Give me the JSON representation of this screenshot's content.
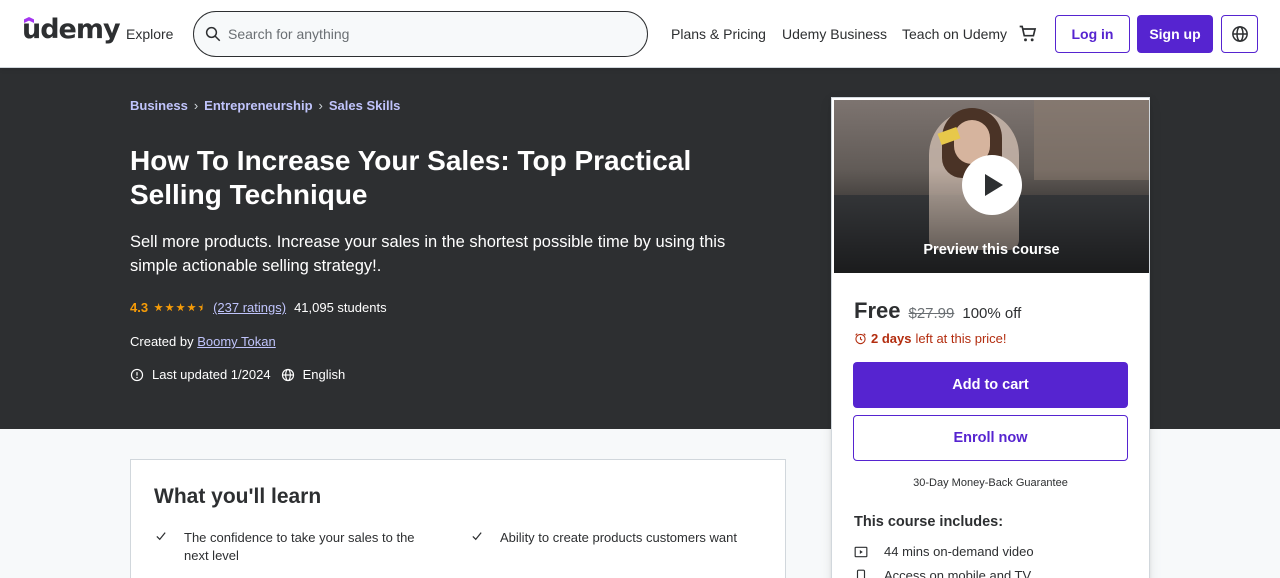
{
  "header": {
    "logo": "udemy",
    "explore": "Explore",
    "search_placeholder": "Search for anything",
    "search_value": "",
    "links": [
      "Plans & Pricing",
      "Udemy Business",
      "Teach on Udemy"
    ],
    "login": "Log in",
    "signup": "Sign up",
    "accent": "#5624d0"
  },
  "breadcrumbs": [
    "Business",
    "Entrepreneurship",
    "Sales Skills"
  ],
  "course": {
    "title": "How To Increase Your Sales: Top Practical Selling Technique",
    "subtitle": "Sell more products. Increase your sales in the shortest possible time by using this simple actionable selling strategy!.",
    "rating": "4.3",
    "rating_stars": 4.3,
    "ratings_link": "(237 ratings)",
    "students": "41,095 students",
    "created_by_label": "Created by",
    "instructor": "Boomy Tokan",
    "last_updated": "Last updated 1/2024",
    "language": "English"
  },
  "card": {
    "preview_label": "Preview this course",
    "price": "Free",
    "original_price": "$27.99",
    "discount": "100% off",
    "timer_bold": "2 days",
    "timer_text": "left at this price!",
    "add_to_cart": "Add to cart",
    "enroll": "Enroll now",
    "guarantee": "30-Day Money-Back Guarantee",
    "includes_title": "This course includes:",
    "includes": [
      "44 mins on-demand video",
      "Access on mobile and TV"
    ]
  },
  "learn": {
    "title": "What you'll learn",
    "items": [
      "The confidence to take your sales to the next level",
      "Ability to create products customers want"
    ]
  }
}
